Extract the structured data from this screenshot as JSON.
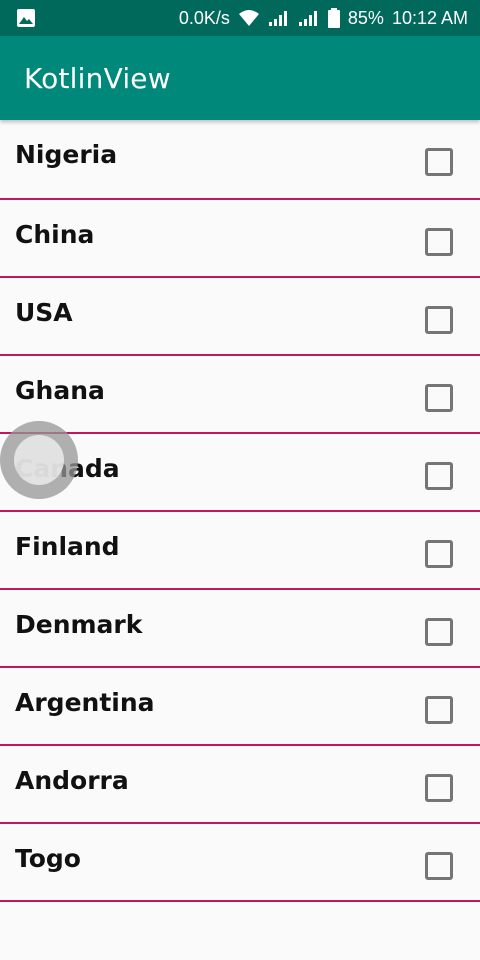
{
  "status_bar": {
    "net_speed": "0.0K/s",
    "battery": "85%",
    "time": "10:12 AM",
    "icons": [
      "gallery-icon",
      "wifi-icon",
      "signal-icon",
      "signal-icon",
      "battery-icon"
    ]
  },
  "app_bar": {
    "title": "KotlinView"
  },
  "countries": [
    {
      "label": "Nigeria",
      "checked": false
    },
    {
      "label": "China",
      "checked": false
    },
    {
      "label": "USA",
      "checked": false
    },
    {
      "label": "Ghana",
      "checked": false
    },
    {
      "label": "Canada",
      "checked": false
    },
    {
      "label": "Finland",
      "checked": false
    },
    {
      "label": "Denmark",
      "checked": false
    },
    {
      "label": "Argentina",
      "checked": false
    },
    {
      "label": "Andorra",
      "checked": false
    },
    {
      "label": "Togo",
      "checked": false
    }
  ],
  "colors": {
    "status_bar": "#00695c",
    "app_bar": "#00897b",
    "divider": "#c2185b",
    "checkbox_border": "#757575"
  }
}
